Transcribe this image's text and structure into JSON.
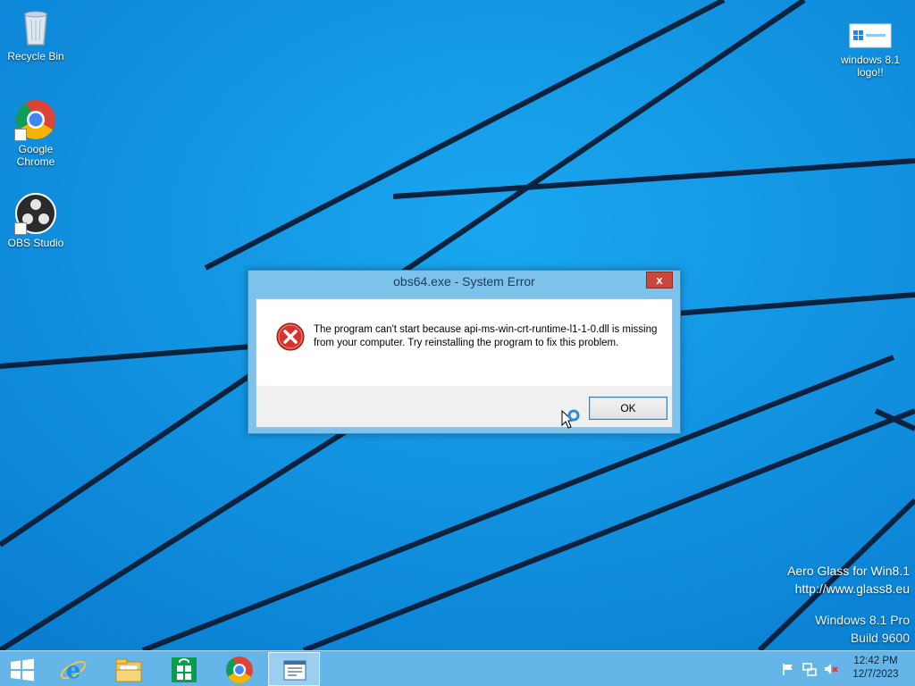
{
  "desktop": {
    "icons": [
      {
        "label": "Recycle Bin",
        "icon": "recycle-bin-icon"
      },
      {
        "label": "Google Chrome",
        "icon": "chrome-icon"
      },
      {
        "label": "OBS Studio",
        "icon": "obs-icon"
      },
      {
        "label": "windows 8.1 logo!!",
        "icon": "image-file-icon"
      }
    ],
    "watermark": {
      "line1": "Aero Glass for Win8.1",
      "line2": "http://www.glass8.eu",
      "os": "Windows 8.1 Pro",
      "build": "Build 9600"
    }
  },
  "dialog": {
    "title": "obs64.exe - System Error",
    "close_label": "x",
    "icon": "error-icon",
    "message": "The program can't start because api-ms-win-crt-runtime-l1-1-0.dll is missing from your computer. Try reinstalling the program to fix this problem.",
    "ok_label": "OK"
  },
  "taskbar": {
    "buttons": [
      {
        "icon": "windows-start-icon"
      },
      {
        "icon": "internet-explorer-icon"
      },
      {
        "icon": "file-explorer-icon"
      },
      {
        "icon": "windows-store-icon"
      },
      {
        "icon": "chrome-icon"
      },
      {
        "icon": "system-error-window-icon"
      }
    ],
    "tray": {
      "icons": [
        "flag-icon",
        "network-icon",
        "volume-muted-icon"
      ],
      "time": "12:42 PM",
      "date": "12/7/2023"
    }
  },
  "colors": {
    "wallpaper": "#0d8fde",
    "taskbar": "#6eb9e8",
    "dialog_frame": "#7dc2ea",
    "close_button": "#c9483d"
  }
}
